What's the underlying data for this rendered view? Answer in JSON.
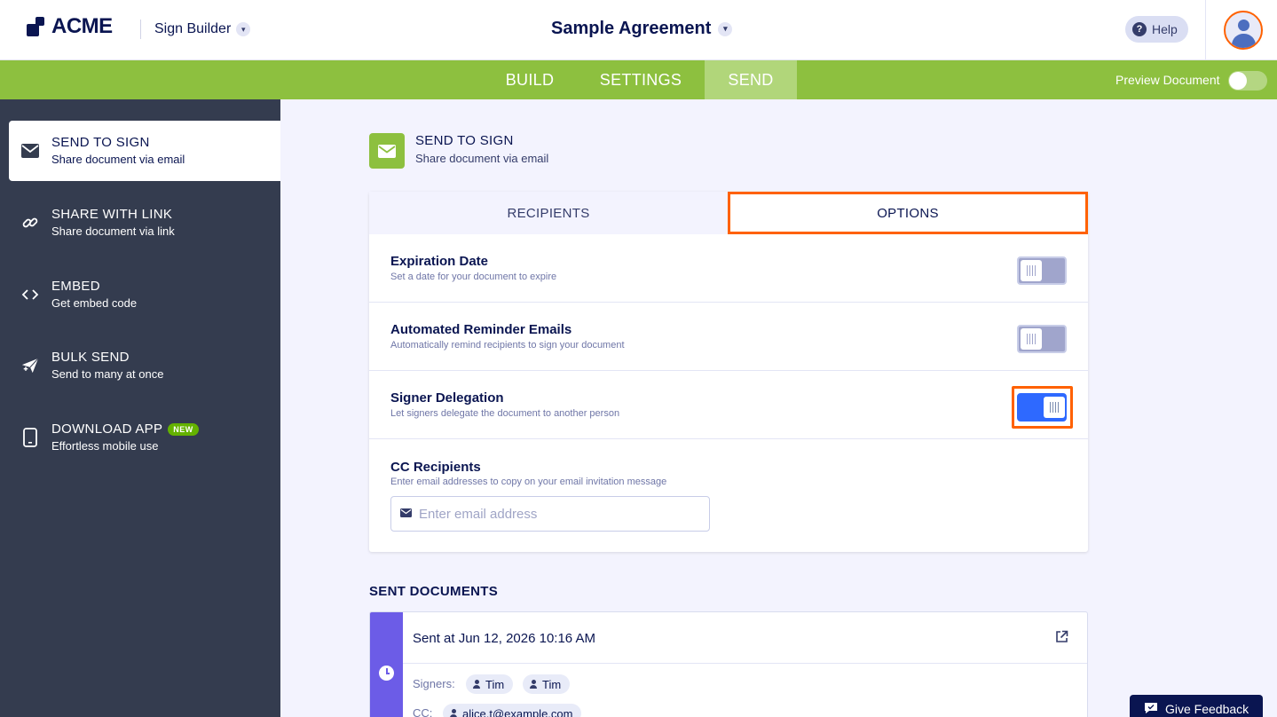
{
  "header": {
    "logo_text": "ACME",
    "app_name": "Sign Builder",
    "doc_title": "Sample Agreement",
    "help_label": "Help"
  },
  "nav": {
    "tabs": [
      {
        "label": "BUILD"
      },
      {
        "label": "SETTINGS"
      },
      {
        "label": "SEND",
        "active": true
      }
    ],
    "preview_label": "Preview Document",
    "preview_on": false
  },
  "sidebar": {
    "items": [
      {
        "title": "SEND TO SIGN",
        "sub": "Share document via email",
        "icon": "mail-icon",
        "active": true
      },
      {
        "title": "SHARE WITH LINK",
        "sub": "Share document via link",
        "icon": "link-icon"
      },
      {
        "title": "EMBED",
        "sub": "Get embed code",
        "icon": "code-icon"
      },
      {
        "title": "BULK SEND",
        "sub": "Send to many at once",
        "icon": "bulk-send-icon"
      },
      {
        "title": "DOWNLOAD APP",
        "sub": "Effortless mobile use",
        "icon": "mobile-icon",
        "badge": "NEW"
      }
    ]
  },
  "main": {
    "section_title": "SEND TO SIGN",
    "section_sub": "Share document via email",
    "tabs": [
      {
        "label": "RECIPIENTS"
      },
      {
        "label": "OPTIONS",
        "active": true
      }
    ],
    "options": [
      {
        "title": "Expiration Date",
        "sub": "Set a date for your document to expire",
        "on": false
      },
      {
        "title": "Automated Reminder Emails",
        "sub": "Automatically remind recipients to sign your document",
        "on": false
      },
      {
        "title": "Signer Delegation",
        "sub": "Let signers delegate the document to another person",
        "on": true
      }
    ],
    "cc": {
      "title": "CC Recipients",
      "sub": "Enter email addresses to copy on your email invitation message",
      "placeholder": "Enter email address",
      "value": ""
    },
    "sent": {
      "title": "SENT DOCUMENTS",
      "sent_at": "Sent at Jun 12, 2026 10:16 AM",
      "signers_label": "Signers:",
      "signers": [
        "Tim",
        "Tim"
      ],
      "cc_label": "CC:",
      "cc": [
        "alice.t@example.com"
      ]
    }
  },
  "feedback_label": "Give Feedback",
  "colors": {
    "nav_green": "#8dc03f",
    "sidebar_bg": "#343c4f",
    "highlight": "#ff6100",
    "toggle_on": "#2e69ff",
    "sent_strip": "#6c5ce7"
  }
}
